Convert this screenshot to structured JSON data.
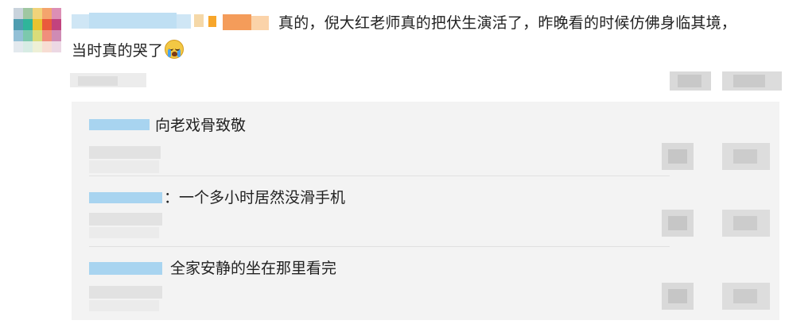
{
  "comment": {
    "text_line1": "真的，倪大红老师真的把伏生演活了，昨晚看的时候仿佛身临其境，",
    "text_line2": "当时真的哭了",
    "emoji": "crying-face-icon"
  },
  "replies": [
    {
      "text": "向老戏骨致敬"
    },
    {
      "text": "：一个多小时居然没滑手机"
    },
    {
      "text": "全家安静的坐在那里看完"
    }
  ],
  "colors": {
    "reply_background": "#f3f3f3",
    "username_blur": "#a8d4f0",
    "meta_blur": "#d9d9d9"
  }
}
